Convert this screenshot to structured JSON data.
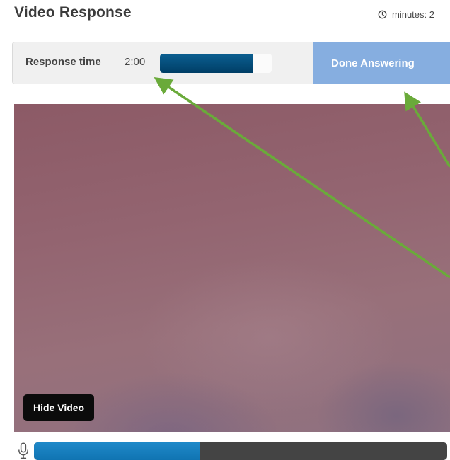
{
  "page": {
    "title": "Video Response"
  },
  "time_limit": {
    "icon": "clock-icon",
    "text": "minutes: 2"
  },
  "toolbar": {
    "response_time_label": "Response time",
    "response_time_value": "2:00",
    "response_time_progress_percent": 83,
    "done_button_label": "Done Answering"
  },
  "video": {
    "hide_button_label": "Hide Video"
  },
  "audio": {
    "icon": "microphone-icon",
    "level_percent": 40
  },
  "colors": {
    "progress_fill": "#0b5f91",
    "done_button": "#86aee0",
    "audio_level": "#1f89c9",
    "annotation_arrow": "#6aaa3a"
  }
}
